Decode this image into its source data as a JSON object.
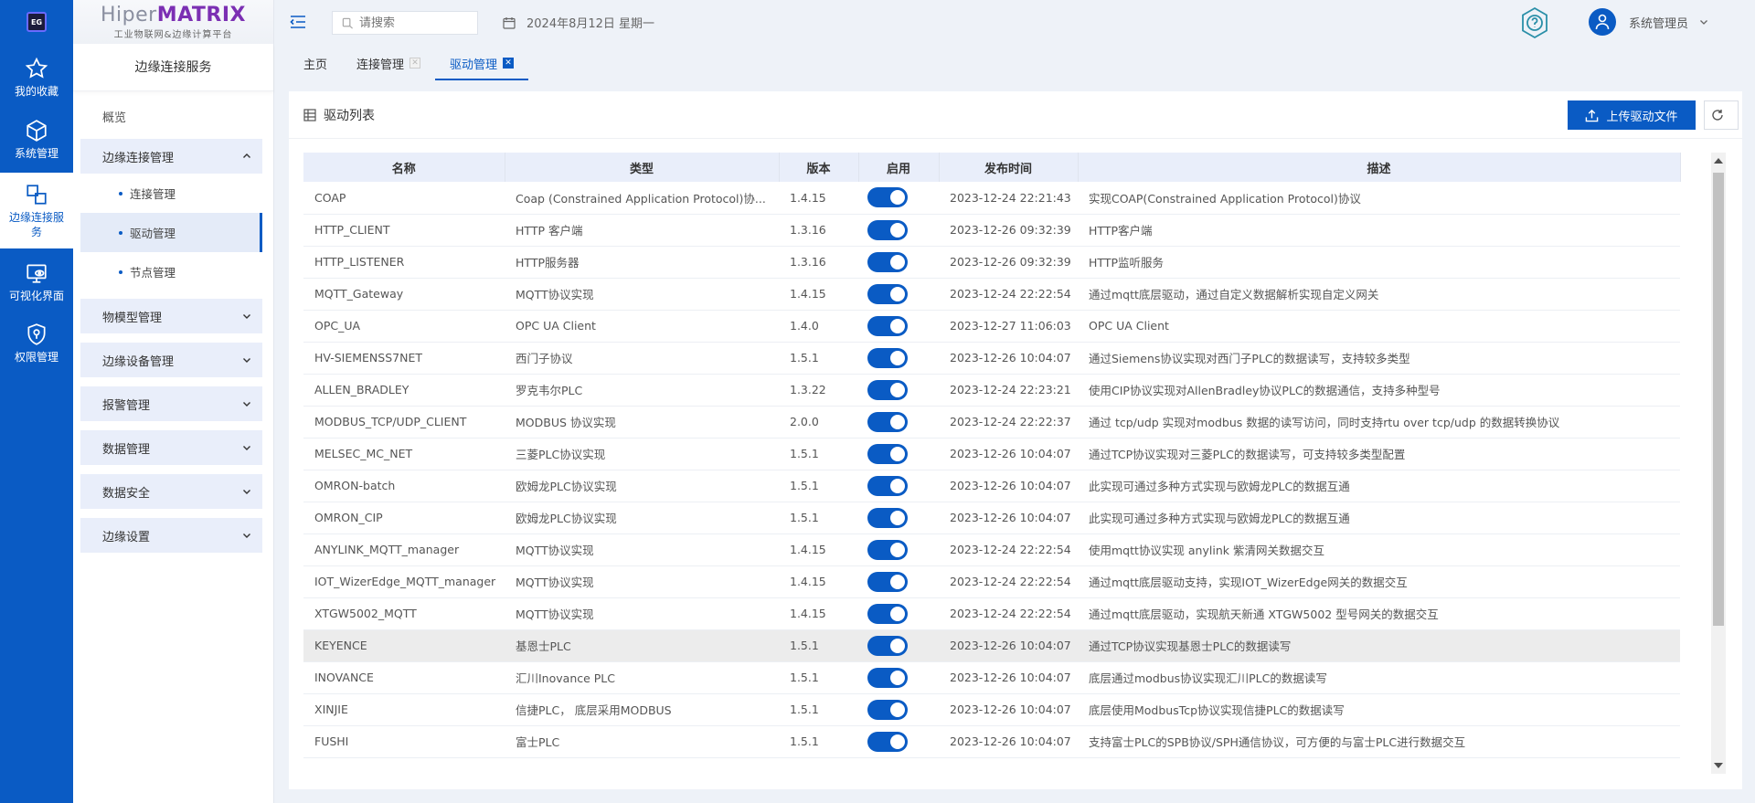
{
  "app": {
    "brand_part1": "Hiper",
    "brand_part2": "MATRIX",
    "brand_subtitle": "工业物联网&边缘计算平台",
    "logo_text": "EG"
  },
  "rail": [
    {
      "label": "我的收藏",
      "icon": "star-icon"
    },
    {
      "label": "系统管理",
      "icon": "cube-icon"
    },
    {
      "label": "边缘连接服务",
      "icon": "connection-icon",
      "active": true
    },
    {
      "label": "可视化界面",
      "icon": "monitor-eye-icon"
    },
    {
      "label": "权限管理",
      "icon": "shield-icon"
    }
  ],
  "sidebar": {
    "title": "边缘连接服务",
    "overview": "概览",
    "group_edge_conn": "边缘连接管理",
    "sub_items": [
      "连接管理",
      "驱动管理",
      "节点管理"
    ],
    "groups": [
      "物模型管理",
      "边缘设备管理",
      "报警管理",
      "数据管理",
      "数据安全",
      "边缘设置"
    ]
  },
  "topbar": {
    "search_placeholder": "请搜索",
    "date": "2024年8月12日 星期一",
    "user_name": "系统管理员"
  },
  "tabs": [
    {
      "label": "主页",
      "closable": false
    },
    {
      "label": "连接管理",
      "closable": true
    },
    {
      "label": "驱动管理",
      "closable": true,
      "active": true
    }
  ],
  "panel": {
    "title": "驱动列表",
    "upload_label": "上传驱动文件"
  },
  "table": {
    "columns": [
      "名称",
      "类型",
      "版本",
      "启用",
      "发布时间",
      "描述"
    ],
    "rows": [
      {
        "name": "COAP",
        "type": "Coap (Constrained Application Protocol)协...",
        "version": "1.4.15",
        "enabled": true,
        "time": "2023-12-24 22:21:43",
        "desc": "实现COAP(Constrained Application Protocol)协议"
      },
      {
        "name": "HTTP_CLIENT",
        "type": "HTTP 客户端",
        "version": "1.3.16",
        "enabled": true,
        "time": "2023-12-26 09:32:39",
        "desc": "HTTP客户端"
      },
      {
        "name": "HTTP_LISTENER",
        "type": "HTTP服务器",
        "version": "1.3.16",
        "enabled": true,
        "time": "2023-12-26 09:32:39",
        "desc": "HTTP监听服务"
      },
      {
        "name": "MQTT_Gateway",
        "type": "MQTT协议实现",
        "version": "1.4.15",
        "enabled": true,
        "time": "2023-12-24 22:22:54",
        "desc": "通过mqtt底层驱动，通过自定义数据解析实现自定义网关"
      },
      {
        "name": "OPC_UA",
        "type": "OPC UA Client",
        "version": "1.4.0",
        "enabled": true,
        "time": "2023-12-27 11:06:03",
        "desc": "OPC UA Client"
      },
      {
        "name": "HV-SIEMENSS7NET",
        "type": "西门子协议",
        "version": "1.5.1",
        "enabled": true,
        "time": "2023-12-26 10:04:07",
        "desc": "通过Siemens协议实现对西门子PLC的数据读写，支持较多类型"
      },
      {
        "name": "ALLEN_BRADLEY",
        "type": "罗克韦尔PLC",
        "version": "1.3.22",
        "enabled": true,
        "time": "2023-12-24 22:23:21",
        "desc": "使用CIP协议实现对AllenBradley协议PLC的数据通信，支持多种型号"
      },
      {
        "name": "MODBUS_TCP/UDP_CLIENT",
        "type": "MODBUS 协议实现",
        "version": "2.0.0",
        "enabled": true,
        "time": "2023-12-24 22:22:37",
        "desc": "通过 tcp/udp 实现对modbus 数据的读写访问，同时支持rtu over tcp/udp 的数据转换协议"
      },
      {
        "name": "MELSEC_MC_NET",
        "type": "三菱PLC协议实现",
        "version": "1.5.1",
        "enabled": true,
        "time": "2023-12-26 10:04:07",
        "desc": "通过TCP协议实现对三菱PLC的数据读写，可支持较多类型配置"
      },
      {
        "name": "OMRON-batch",
        "type": "欧姆龙PLC协议实现",
        "version": "1.5.1",
        "enabled": true,
        "time": "2023-12-26 10:04:07",
        "desc": "此实现可通过多种方式实现与欧姆龙PLC的数据互通"
      },
      {
        "name": "OMRON_CIP",
        "type": "欧姆龙PLC协议实现",
        "version": "1.5.1",
        "enabled": true,
        "time": "2023-12-26 10:04:07",
        "desc": "此实现可通过多种方式实现与欧姆龙PLC的数据互通"
      },
      {
        "name": "ANYLINK_MQTT_manager",
        "type": "MQTT协议实现",
        "version": "1.4.15",
        "enabled": true,
        "time": "2023-12-24 22:22:54",
        "desc": "使用mqtt协议实现 anylink 紫清网关数据交互"
      },
      {
        "name": "IOT_WizerEdge_MQTT_manager",
        "type": "MQTT协议实现",
        "version": "1.4.15",
        "enabled": true,
        "time": "2023-12-24 22:22:54",
        "desc": "通过mqtt底层驱动支持，实现IOT_WizerEdge网关的数据交互"
      },
      {
        "name": "XTGW5002_MQTT",
        "type": "MQTT协议实现",
        "version": "1.4.15",
        "enabled": true,
        "time": "2023-12-24 22:22:54",
        "desc": "通过mqtt底层驱动，实现航天新通 XTGW5002 型号网关的数据交互"
      },
      {
        "name": "KEYENCE",
        "type": "基恩士PLC",
        "version": "1.5.1",
        "enabled": true,
        "time": "2023-12-26 10:04:07",
        "desc": "通过TCP协议实现基恩士PLC的数据读写",
        "highlight": true
      },
      {
        "name": "INOVANCE",
        "type": "汇川Inovance PLC",
        "version": "1.5.1",
        "enabled": true,
        "time": "2023-12-26 10:04:07",
        "desc": "底层通过modbus协议实现汇川PLC的数据读写"
      },
      {
        "name": "XINJIE",
        "type": "信捷PLC， 底层采用MODBUS",
        "version": "1.5.1",
        "enabled": true,
        "time": "2023-12-26 10:04:07",
        "desc": "底层使用ModbusTcp协议实现信捷PLC的数据读写"
      },
      {
        "name": "FUSHI",
        "type": "富士PLC",
        "version": "1.5.1",
        "enabled": true,
        "time": "2023-12-26 10:04:07",
        "desc": "支持富士PLC的SPB协议/SPH通信协议，可方便的与富士PLC进行数据交互"
      }
    ]
  },
  "colors": {
    "primary": "#0a5bc4",
    "row_highlight": "#ececec",
    "header_bg": "#e9eefa"
  }
}
